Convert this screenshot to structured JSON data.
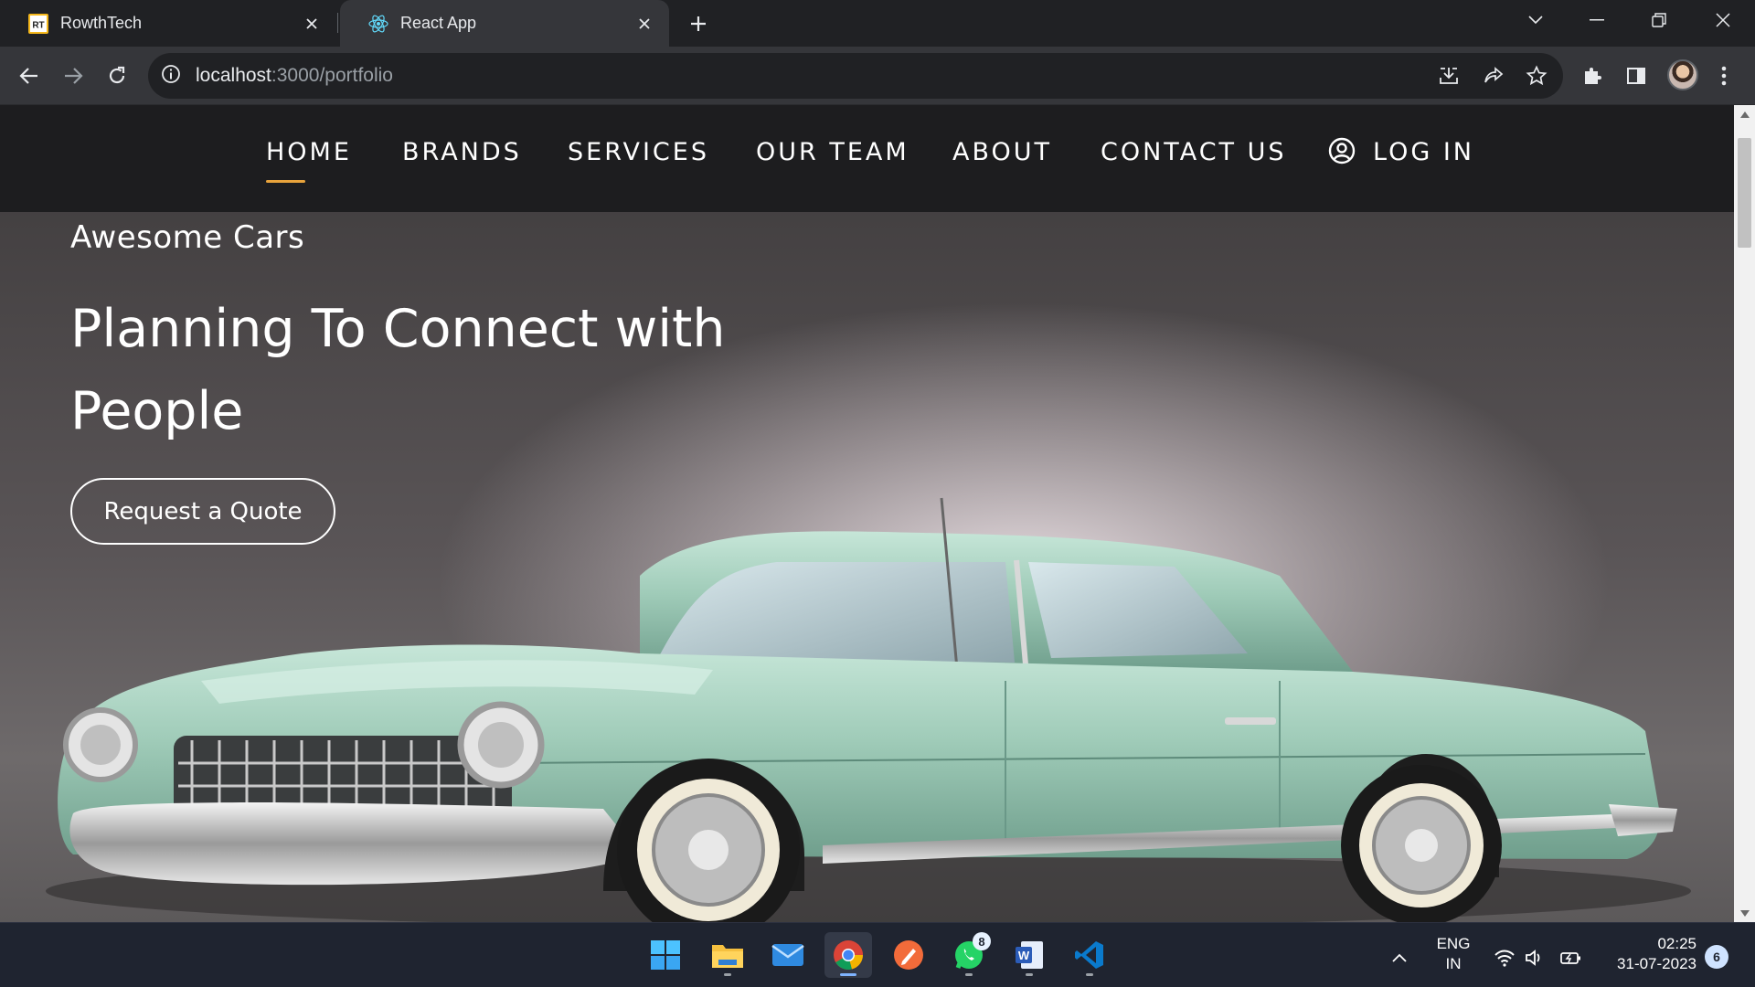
{
  "browser": {
    "tabs": [
      {
        "title": "RowthTech",
        "favicon": "RT"
      },
      {
        "title": "React App"
      }
    ],
    "url_host": "localhost",
    "url_rest": ":3000/portfolio"
  },
  "navbar": {
    "items": [
      "HOME",
      "BRANDS",
      "SERVICES",
      "OUR TEAM",
      "ABOUT",
      "CONTACT US"
    ],
    "login": "LOG IN",
    "active_underline_color": "#e8a33c"
  },
  "hero": {
    "subtitle": "Awesome Cars",
    "title": "Planning To Connect with People",
    "cta": "Request a Quote"
  },
  "taskbar": {
    "apps": [
      "windows-start",
      "file-explorer",
      "mail",
      "chrome",
      "pen-app",
      "whatsapp",
      "word",
      "vscode"
    ],
    "whatsapp_badge": "8",
    "language_line1": "ENG",
    "language_line2": "IN",
    "time": "02:25",
    "date": "31-07-2023",
    "notifications": "6"
  },
  "colors": {
    "navbar_bg": "#1d1d1f",
    "car_body": "#9fcbb8",
    "taskbar_bg": "#1f2430"
  }
}
